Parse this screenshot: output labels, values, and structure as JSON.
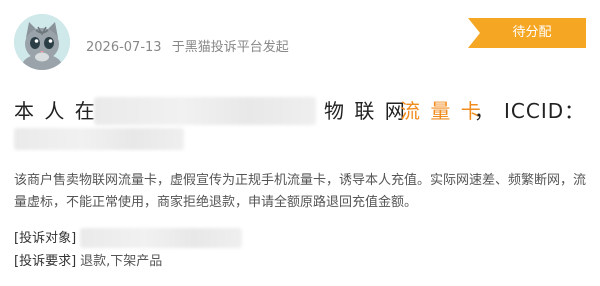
{
  "header": {
    "date": "2026-07-13",
    "source_text": "于黑猫投诉平台发起",
    "status_badge": "待分配"
  },
  "title": {
    "prefix": "本 人 在",
    "middle": "物 联 网",
    "highlight": "流 量 卡",
    "comma": "，",
    "iccid_label": "ICCID："
  },
  "description": "该商户售卖物联网流量卡，虚假宣传为正规手机流量卡，诱导本人充值。实际网速差、频繁断网，流量虚标，不能正常使用，商家拒绝退款，申请全额原路退回充值金额。",
  "fields": {
    "target_label": "[投诉对象]",
    "request_label": "[投诉要求]",
    "request_value": "退款,下架产品"
  },
  "colors": {
    "accent": "#f08c1e",
    "badge": "#f5a623"
  }
}
